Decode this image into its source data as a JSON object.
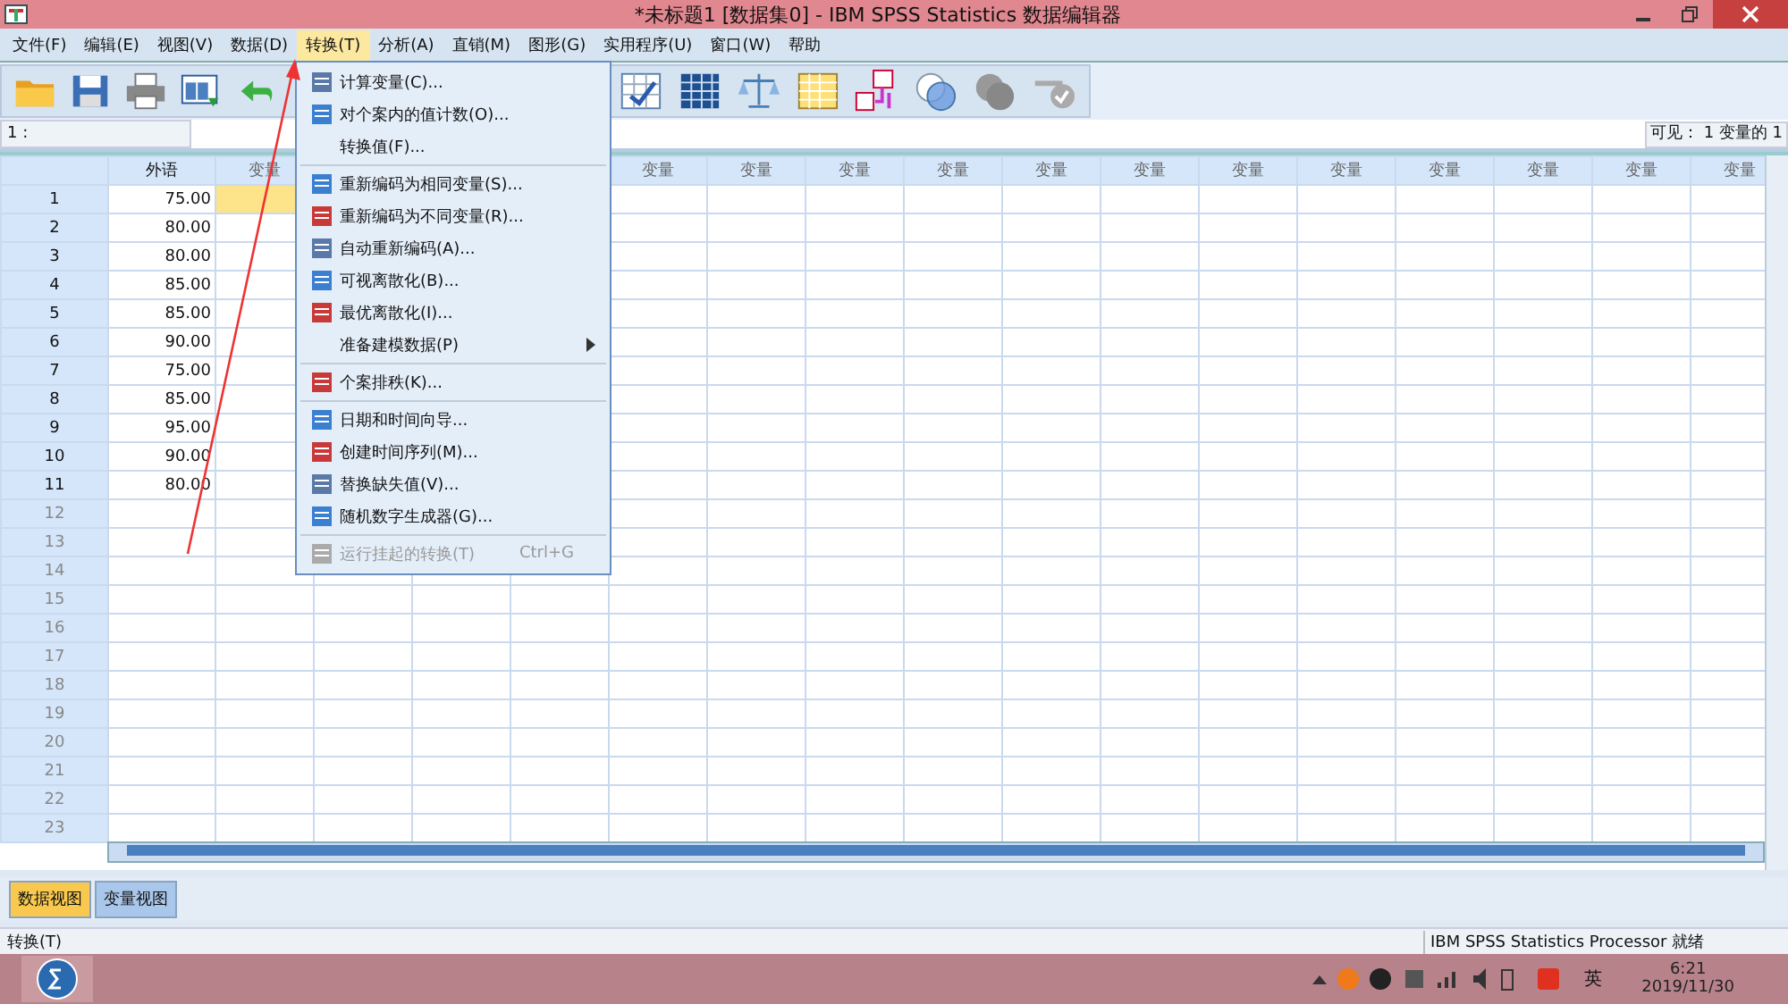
{
  "window": {
    "title": "*未标题1 [数据集0] - IBM SPSS Statistics 数据编辑器"
  },
  "menu_bar": [
    {
      "label": "文件(F)",
      "selected": false
    },
    {
      "label": "编辑(E)",
      "selected": false
    },
    {
      "label": "视图(V)",
      "selected": false
    },
    {
      "label": "数据(D)",
      "selected": false
    },
    {
      "label": "转换(T)",
      "selected": true
    },
    {
      "label": "分析(A)",
      "selected": false
    },
    {
      "label": "直销(M)",
      "selected": false
    },
    {
      "label": "图形(G)",
      "selected": false
    },
    {
      "label": "实用程序(U)",
      "selected": false
    },
    {
      "label": "窗口(W)",
      "selected": false
    },
    {
      "label": "帮助",
      "selected": false
    }
  ],
  "dropdown_menu": [
    {
      "kind": "item",
      "label": "计算变量(C)..."
    },
    {
      "kind": "item",
      "label": "对个案内的值计数(O)..."
    },
    {
      "kind": "item",
      "label": "转换值(F)..."
    },
    {
      "kind": "separator"
    },
    {
      "kind": "item",
      "label": "重新编码为相同变量(S)..."
    },
    {
      "kind": "item",
      "label": "重新编码为不同变量(R)..."
    },
    {
      "kind": "item",
      "label": "自动重新编码(A)..."
    },
    {
      "kind": "item",
      "label": "可视离散化(B)..."
    },
    {
      "kind": "item",
      "label": "最优离散化(I)..."
    },
    {
      "kind": "submenu",
      "label": "准备建模数据(P)"
    },
    {
      "kind": "separator"
    },
    {
      "kind": "item",
      "label": "个案排秩(K)..."
    },
    {
      "kind": "separator"
    },
    {
      "kind": "item",
      "label": "日期和时间向导..."
    },
    {
      "kind": "item",
      "label": "创建时间序列(M)..."
    },
    {
      "kind": "item",
      "label": "替换缺失值(V)..."
    },
    {
      "kind": "item",
      "label": "随机数字生成器(G)..."
    },
    {
      "kind": "separator"
    },
    {
      "kind": "disabled",
      "label": "运行挂起的转换(T)",
      "shortcut": "Ctrl+G"
    }
  ],
  "cell_reference": {
    "label": "1 :"
  },
  "visible_info": "可见： 1 变量的 1",
  "table": {
    "columns": [
      {
        "label": "外语",
        "kind": "variable"
      },
      {
        "label": "变量",
        "kind": "placeholder"
      },
      {
        "kind": "placeholder"
      },
      {
        "kind": "placeholder"
      },
      {
        "kind": "placeholder"
      },
      {
        "label": "变量",
        "kind": "placeholder"
      },
      {
        "label": "变量",
        "kind": "placeholder"
      },
      {
        "label": "变量",
        "kind": "placeholder"
      },
      {
        "label": "变量",
        "kind": "placeholder"
      },
      {
        "label": "变量",
        "kind": "placeholder"
      },
      {
        "label": "变量",
        "kind": "placeholder"
      },
      {
        "label": "变量",
        "kind": "placeholder"
      },
      {
        "label": "变量",
        "kind": "placeholder"
      },
      {
        "label": "变量",
        "kind": "placeholder"
      },
      {
        "label": "变量",
        "kind": "placeholder"
      },
      {
        "label": "变量",
        "kind": "placeholder"
      },
      {
        "label": "变量",
        "kind": "placeholder"
      }
    ],
    "rows": [
      {
        "label": "1",
        "value": "75.00",
        "current": true
      },
      {
        "label": "2",
        "value": "80.00",
        "current": false
      },
      {
        "label": "3",
        "value": "80.00",
        "current": false
      },
      {
        "label": "4",
        "value": "85.00",
        "current": false
      },
      {
        "label": "5",
        "value": "85.00",
        "current": false
      },
      {
        "label": "6",
        "value": "90.00",
        "current": false
      },
      {
        "label": "7",
        "value": "75.00",
        "current": false
      },
      {
        "label": "8",
        "value": "85.00",
        "current": false
      },
      {
        "label": "9",
        "value": "95.00",
        "current": false
      },
      {
        "label": "10",
        "value": "90.00",
        "current": false
      },
      {
        "label": "11",
        "value": "80.00",
        "current": false
      },
      {
        "label": "12",
        "current": false
      },
      {
        "label": "13",
        "current": false
      },
      {
        "label": "14",
        "current": false
      },
      {
        "label": "15",
        "current": false
      },
      {
        "label": "16",
        "current": false
      },
      {
        "label": "17",
        "current": false
      },
      {
        "label": "18",
        "current": false
      },
      {
        "label": "19",
        "current": false
      },
      {
        "label": "20",
        "current": false
      },
      {
        "label": "21",
        "current": false
      },
      {
        "label": "22",
        "current": false
      },
      {
        "label": "23",
        "current": false
      }
    ]
  },
  "view_tabs": [
    {
      "label": "数据视图",
      "selected": true
    },
    {
      "label": "变量视图",
      "selected": false
    }
  ],
  "status_bar": {
    "left": "转换(T)",
    "right": "IBM SPSS Statistics Processor 就绪"
  },
  "taskbar": {
    "ime": "英",
    "time": "6:21",
    "date": "2019/11/30"
  }
}
